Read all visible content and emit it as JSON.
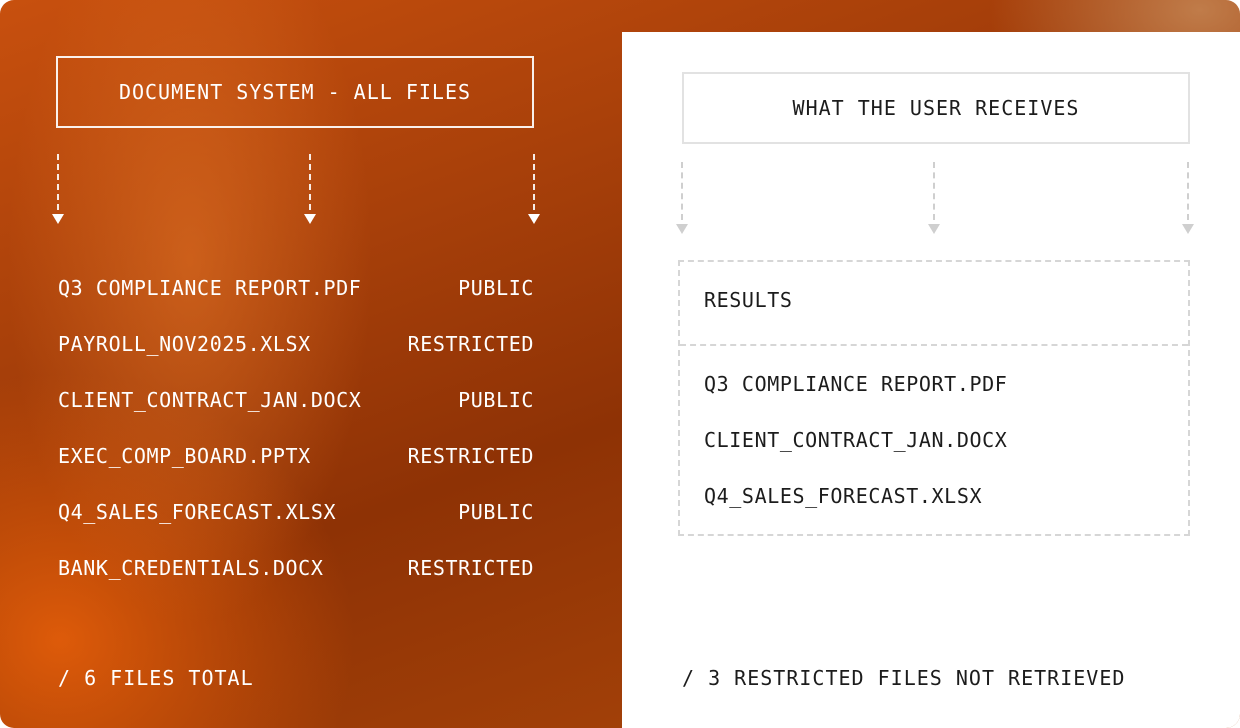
{
  "left_panel": {
    "title": "DOCUMENT SYSTEM - ALL FILES",
    "files": [
      {
        "name": "Q3 COMPLIANCE REPORT.PDF",
        "access": "PUBLIC"
      },
      {
        "name": "PAYROLL_NOV2025.XLSX",
        "access": "RESTRICTED"
      },
      {
        "name": "CLIENT_CONTRACT_JAN.DOCX",
        "access": "PUBLIC"
      },
      {
        "name": "EXEC_COMP_BOARD.PPTX",
        "access": "RESTRICTED"
      },
      {
        "name": "Q4_SALES_FORECAST.XLSX",
        "access": "PUBLIC"
      },
      {
        "name": "BANK_CREDENTIALS.DOCX",
        "access": "RESTRICTED"
      }
    ],
    "footer": "/ 6 FILES TOTAL"
  },
  "right_panel": {
    "title": "WHAT THE USER RECEIVES",
    "results_label": "RESULTS",
    "results": [
      "Q3 COMPLIANCE REPORT.PDF",
      "CLIENT_CONTRACT_JAN.DOCX",
      "Q4_SALES_FORECAST.XLSX"
    ],
    "footer": "/ 3 RESTRICTED FILES NOT RETRIEVED"
  },
  "colors": {
    "accent_orange": "#c8500e",
    "dark_rust": "#8e3205",
    "text_light": "#ffffff",
    "text_dark": "#1c1c1c",
    "dashed_gray": "#d6d6d6"
  }
}
